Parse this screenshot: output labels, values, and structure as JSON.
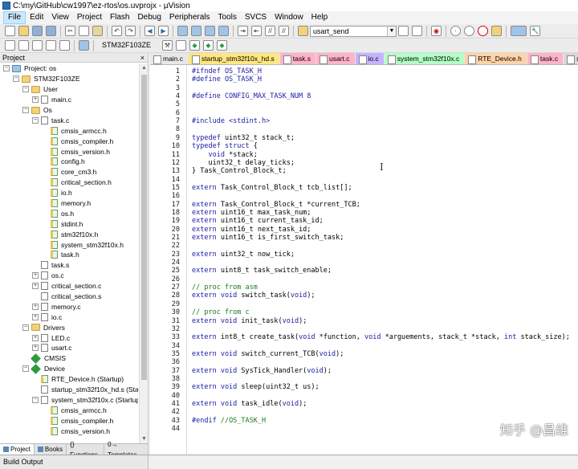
{
  "window": {
    "title": "C:\\my\\GitHub\\cw1997\\ez-rtos\\os.uvprojx - µVision"
  },
  "menu": [
    "File",
    "Edit",
    "View",
    "Project",
    "Flash",
    "Debug",
    "Peripherals",
    "Tools",
    "SVCS",
    "Window",
    "Help"
  ],
  "toolbar": {
    "find_combo": "usart_send",
    "target_combo": "STM32F103ZE"
  },
  "project_panel": {
    "title": "Project",
    "close": "×"
  },
  "tree": [
    {
      "label": "Project: os",
      "level": 0,
      "exp": "−",
      "icon": "proj"
    },
    {
      "label": "STM32F103ZE",
      "level": 1,
      "exp": "−",
      "icon": "folder"
    },
    {
      "label": "User",
      "level": 2,
      "exp": "−",
      "icon": "folder"
    },
    {
      "label": "main.c",
      "level": 3,
      "exp": "+",
      "icon": "file"
    },
    {
      "label": "Os",
      "level": 2,
      "exp": "−",
      "icon": "folder"
    },
    {
      "label": "task.c",
      "level": 3,
      "exp": "−",
      "icon": "file"
    },
    {
      "label": "cmsis_armcc.h",
      "level": 4,
      "exp": "",
      "icon": "hfile"
    },
    {
      "label": "cmsis_compiler.h",
      "level": 4,
      "exp": "",
      "icon": "hfile"
    },
    {
      "label": "cmsis_version.h",
      "level": 4,
      "exp": "",
      "icon": "hfile"
    },
    {
      "label": "config.h",
      "level": 4,
      "exp": "",
      "icon": "hfile"
    },
    {
      "label": "core_cm3.h",
      "level": 4,
      "exp": "",
      "icon": "hfile"
    },
    {
      "label": "critical_section.h",
      "level": 4,
      "exp": "",
      "icon": "hfile"
    },
    {
      "label": "io.h",
      "level": 4,
      "exp": "",
      "icon": "hfile"
    },
    {
      "label": "memory.h",
      "level": 4,
      "exp": "",
      "icon": "hfile"
    },
    {
      "label": "os.h",
      "level": 4,
      "exp": "",
      "icon": "hfile"
    },
    {
      "label": "stdint.h",
      "level": 4,
      "exp": "",
      "icon": "hfile"
    },
    {
      "label": "stm32f10x.h",
      "level": 4,
      "exp": "",
      "icon": "hfile"
    },
    {
      "label": "system_stm32f10x.h",
      "level": 4,
      "exp": "",
      "icon": "hfile"
    },
    {
      "label": "task.h",
      "level": 4,
      "exp": "",
      "icon": "hfile"
    },
    {
      "label": "task.s",
      "level": 3,
      "exp": "",
      "icon": "file"
    },
    {
      "label": "os.c",
      "level": 3,
      "exp": "+",
      "icon": "file"
    },
    {
      "label": "critical_section.c",
      "level": 3,
      "exp": "+",
      "icon": "file"
    },
    {
      "label": "critical_section.s",
      "level": 3,
      "exp": "",
      "icon": "file"
    },
    {
      "label": "memory.c",
      "level": 3,
      "exp": "+",
      "icon": "file"
    },
    {
      "label": "io.c",
      "level": 3,
      "exp": "+",
      "icon": "file"
    },
    {
      "label": "Drivers",
      "level": 2,
      "exp": "−",
      "icon": "folder"
    },
    {
      "label": "LED.c",
      "level": 3,
      "exp": "+",
      "icon": "file"
    },
    {
      "label": "usart.c",
      "level": 3,
      "exp": "+",
      "icon": "file"
    },
    {
      "label": "CMSIS",
      "level": 2,
      "exp": "",
      "icon": "diamond"
    },
    {
      "label": "Device",
      "level": 2,
      "exp": "−",
      "icon": "diamond"
    },
    {
      "label": "RTE_Device.h (Startup)",
      "level": 3,
      "exp": "",
      "icon": "hfile"
    },
    {
      "label": "startup_stm32f10x_hd.s (Startu",
      "level": 3,
      "exp": "",
      "icon": "file"
    },
    {
      "label": "system_stm32f10x.c (Startup)",
      "level": 3,
      "exp": "−",
      "icon": "file"
    },
    {
      "label": "cmsis_armcc.h",
      "level": 4,
      "exp": "",
      "icon": "hfile"
    },
    {
      "label": "cmsis_compiler.h",
      "level": 4,
      "exp": "",
      "icon": "hfile"
    },
    {
      "label": "cmsis_version.h",
      "level": 4,
      "exp": "",
      "icon": "hfile"
    }
  ],
  "bottom_tabs": [
    "Project",
    "Books",
    "{} Functions",
    "0→ Templates"
  ],
  "editor_tabs": [
    {
      "label": "main.c",
      "color": "#e8e8e8"
    },
    {
      "label": "startup_stm32f10x_hd.s",
      "color": "#ffe680"
    },
    {
      "label": "task.s",
      "color": "#ffb3c7"
    },
    {
      "label": "usart.c",
      "color": "#ffb3c7"
    },
    {
      "label": "io.c",
      "color": "#c6b3ff"
    },
    {
      "label": "system_stm32f10x.c",
      "color": "#b3ffc6"
    },
    {
      "label": "RTE_Device.h",
      "color": "#ffd3a8"
    },
    {
      "label": "task.c",
      "color": "#ffb3c7"
    },
    {
      "label": "s",
      "color": "#d8d8d8"
    }
  ],
  "code": [
    [
      {
        "t": "#ifndef OS_TASK_H",
        "c": "pp"
      }
    ],
    [
      {
        "t": "#define OS_TASK_H",
        "c": "pp"
      }
    ],
    [],
    [
      {
        "t": "#define CONFIG_MAX_TASK_NUM 8",
        "c": "pp"
      }
    ],
    [],
    [],
    [
      {
        "t": "#include <stdint.h>",
        "c": "pp"
      }
    ],
    [],
    [
      {
        "t": "typedef",
        "c": "kw"
      },
      {
        "t": " uint32_t stack_t;",
        "c": "id"
      }
    ],
    [
      {
        "t": "typedef struct",
        "c": "kw"
      },
      {
        "t": " {",
        "c": "id"
      }
    ],
    [
      {
        "t": "    "
      },
      {
        "t": "void",
        "c": "kw"
      },
      {
        "t": " *stack;",
        "c": "id"
      }
    ],
    [
      {
        "t": "    uint32_t delay_ticks;",
        "c": "id"
      }
    ],
    [
      {
        "t": "} Task_Control_Block_t;",
        "c": "id"
      }
    ],
    [],
    [
      {
        "t": "extern",
        "c": "kw"
      },
      {
        "t": " Task_Control_Block_t tcb_list[];",
        "c": "id"
      }
    ],
    [],
    [
      {
        "t": "extern",
        "c": "kw"
      },
      {
        "t": " Task_Control_Block_t *current_TCB;",
        "c": "id"
      }
    ],
    [
      {
        "t": "extern",
        "c": "kw"
      },
      {
        "t": " uint16_t max_task_num;",
        "c": "id"
      }
    ],
    [
      {
        "t": "extern",
        "c": "kw"
      },
      {
        "t": " uint16_t current_task_id;",
        "c": "id"
      }
    ],
    [
      {
        "t": "extern",
        "c": "kw"
      },
      {
        "t": " uint16_t next_task_id;",
        "c": "id"
      }
    ],
    [
      {
        "t": "extern",
        "c": "kw"
      },
      {
        "t": " uint16_t is_first_switch_task;",
        "c": "id"
      }
    ],
    [],
    [
      {
        "t": "extern",
        "c": "kw"
      },
      {
        "t": " uint32_t now_tick;",
        "c": "id"
      }
    ],
    [],
    [
      {
        "t": "extern",
        "c": "kw"
      },
      {
        "t": " uint8_t task_switch_enable;",
        "c": "id"
      }
    ],
    [],
    [
      {
        "t": "// proc from asm",
        "c": "cm"
      }
    ],
    [
      {
        "t": "extern void",
        "c": "kw"
      },
      {
        "t": " switch_task(",
        "c": "id"
      },
      {
        "t": "void",
        "c": "kw"
      },
      {
        "t": ");",
        "c": "id"
      }
    ],
    [],
    [
      {
        "t": "// proc from c",
        "c": "cm"
      }
    ],
    [
      {
        "t": "extern void",
        "c": "kw"
      },
      {
        "t": " init_task(",
        "c": "id"
      },
      {
        "t": "void",
        "c": "kw"
      },
      {
        "t": ");",
        "c": "id"
      }
    ],
    [],
    [
      {
        "t": "extern",
        "c": "kw"
      },
      {
        "t": " int8_t create_task(",
        "c": "id"
      },
      {
        "t": "void",
        "c": "kw"
      },
      {
        "t": " *function, ",
        "c": "id"
      },
      {
        "t": "void",
        "c": "kw"
      },
      {
        "t": " *arguements, stack_t *stack, ",
        "c": "id"
      },
      {
        "t": "int",
        "c": "kw"
      },
      {
        "t": " stack_size);",
        "c": "id"
      }
    ],
    [],
    [
      {
        "t": "extern void",
        "c": "kw"
      },
      {
        "t": " switch_current_TCB(",
        "c": "id"
      },
      {
        "t": "void",
        "c": "kw"
      },
      {
        "t": ");",
        "c": "id"
      }
    ],
    [],
    [
      {
        "t": "extern void",
        "c": "kw"
      },
      {
        "t": " SysTick_Handler(",
        "c": "id"
      },
      {
        "t": "void",
        "c": "kw"
      },
      {
        "t": ");",
        "c": "id"
      }
    ],
    [],
    [
      {
        "t": "extern void",
        "c": "kw"
      },
      {
        "t": " sleep(uint32_t us);",
        "c": "id"
      }
    ],
    [],
    [
      {
        "t": "extern void",
        "c": "kw"
      },
      {
        "t": " task_idle(",
        "c": "id"
      },
      {
        "t": "void",
        "c": "kw"
      },
      {
        "t": ");",
        "c": "id"
      }
    ],
    [],
    [
      {
        "t": "#endif ",
        "c": "pp"
      },
      {
        "t": "//OS_TASK_H",
        "c": "cm"
      }
    ],
    []
  ],
  "colors": {
    "keyword": "#1a1aa6",
    "preprocessor": "#1a1aa6",
    "comment": "#1f7a1f",
    "identifier": "#000000"
  },
  "watermark": "知乎 @昌维",
  "status": {
    "build_output": "Build Output"
  }
}
